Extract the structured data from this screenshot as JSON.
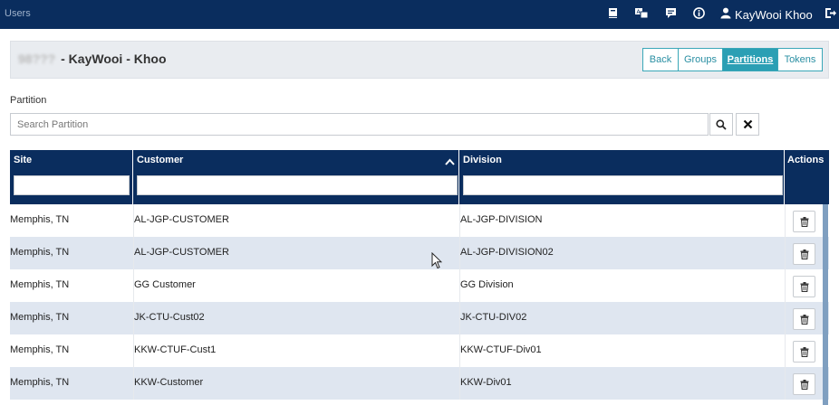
{
  "topbar": {
    "app_title": "Users",
    "icons": [
      "book-icon",
      "translate-icon",
      "message-icon",
      "info-icon",
      "user-icon",
      "logout-icon"
    ],
    "user_name": "KayWooi Khoo"
  },
  "header": {
    "id_obscured": "98???",
    "title": "- KayWooi - Khoo",
    "buttons": [
      {
        "label": "Back",
        "active": false
      },
      {
        "label": "Groups",
        "active": false
      },
      {
        "label": "Partitions",
        "active": true
      },
      {
        "label": "Tokens",
        "active": false
      }
    ]
  },
  "partition": {
    "label": "Partition",
    "search_placeholder": "Search Partition"
  },
  "table": {
    "columns": [
      "Site",
      "Customer",
      "Division",
      "Actions"
    ],
    "sorted_column": "Customer",
    "sort_direction": "ascending",
    "rows": [
      {
        "site": "Memphis, TN",
        "customer": "AL-JGP-CUSTOMER",
        "division": "AL-JGP-DIVISION"
      },
      {
        "site": "Memphis, TN",
        "customer": "AL-JGP-CUSTOMER",
        "division": "AL-JGP-DIVISION02"
      },
      {
        "site": "Memphis, TN",
        "customer": "GG Customer",
        "division": "GG Division"
      },
      {
        "site": "Memphis, TN",
        "customer": "JK-CTU-Cust02",
        "division": "JK-CTU-DIV02"
      },
      {
        "site": "Memphis, TN",
        "customer": "KKW-CTUF-Cust1",
        "division": "KKW-CTUF-Div01"
      },
      {
        "site": "Memphis, TN",
        "customer": "KKW-Customer",
        "division": "KKW-Div01"
      }
    ]
  },
  "colors": {
    "navy": "#0a2d5e",
    "accent": "#2b9fb4",
    "row_alt": "#dfe6f0"
  }
}
